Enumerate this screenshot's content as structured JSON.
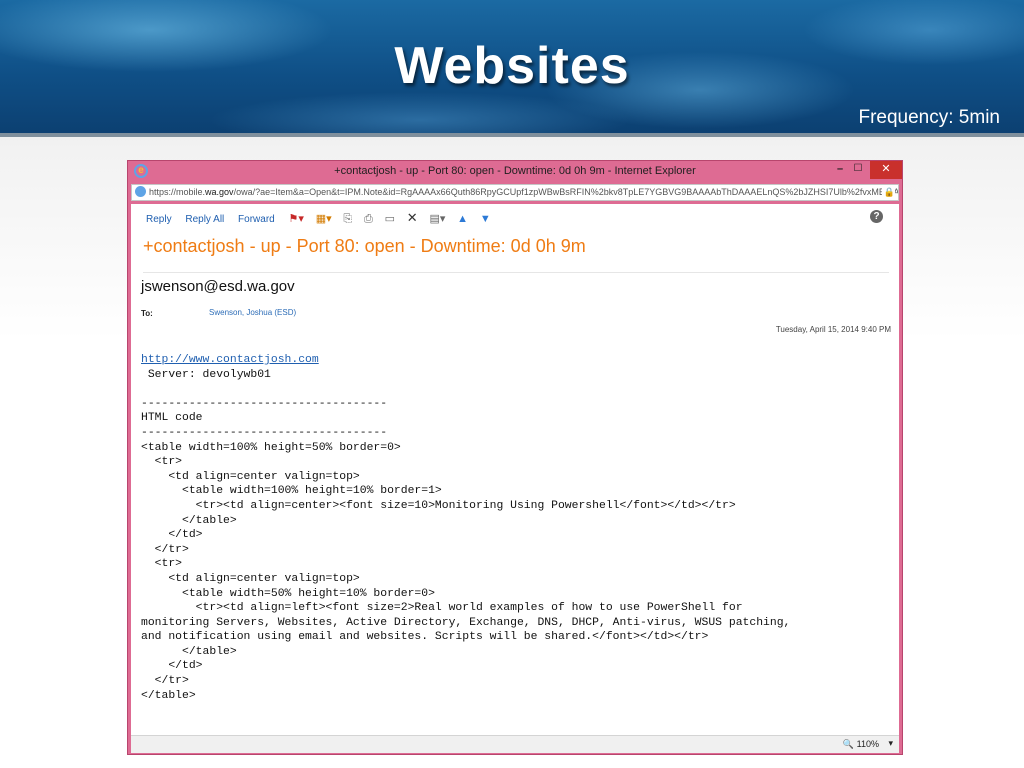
{
  "slide": {
    "title": "Websites",
    "subtitle": "Frequency: 5min"
  },
  "browser": {
    "window_title": "+contactjosh - up - Port 80: open - Downtime: 0d 0h 9m - Internet Explorer",
    "address_prefix": "https://mobile.",
    "address_domain": "wa.gov",
    "address_rest": "/owa/?ae=Item&a=Open&t=IPM.Note&id=RgAAAAx66Quth86RpyGCUpf1zpWBwBsRFIN%2bkv8TpLE7YGBVG9BAAAAbThDAAAELnQS%2bJZHSI7Ulb%2fvxMBtAAAo",
    "zoom": "110%"
  },
  "toolbar": {
    "reply": "Reply",
    "reply_all": "Reply All",
    "forward": "Forward"
  },
  "email": {
    "subject": "+contactjosh - up - Port 80: open - Downtime: 0d 0h 9m",
    "sender": "jswenson@esd.wa.gov",
    "to_label": "To:",
    "to_value": "Swenson, Joshua (ESD)",
    "date": "Tuesday, April 15, 2014 9:40 PM",
    "link": "http://www.contactjosh.com",
    "server_line": " Server: devolywb01",
    "body_rest": "------------------------------------\nHTML code\n------------------------------------\n<table width=100% height=50% border=0>\n  <tr>\n    <td align=center valign=top>\n      <table width=100% height=10% border=1>\n        <tr><td align=center><font size=10>Monitoring Using Powershell</font></td></tr>\n      </table>\n    </td>\n  </tr>\n  <tr>\n    <td align=center valign=top>\n      <table width=50% height=10% border=0>\n        <tr><td align=left><font size=2>Real world examples of how to use PowerShell for\nmonitoring Servers, Websites, Active Directory, Exchange, DNS, DHCP, Anti-virus, WSUS patching,\nand notification using email and websites. Scripts will be shared.</font></td></tr>\n      </table>\n    </td>\n  </tr>\n</table>"
  },
  "colors": {
    "window_frame": "#de6b93",
    "subject": "#ef7c14",
    "link": "#1f5fb0"
  }
}
